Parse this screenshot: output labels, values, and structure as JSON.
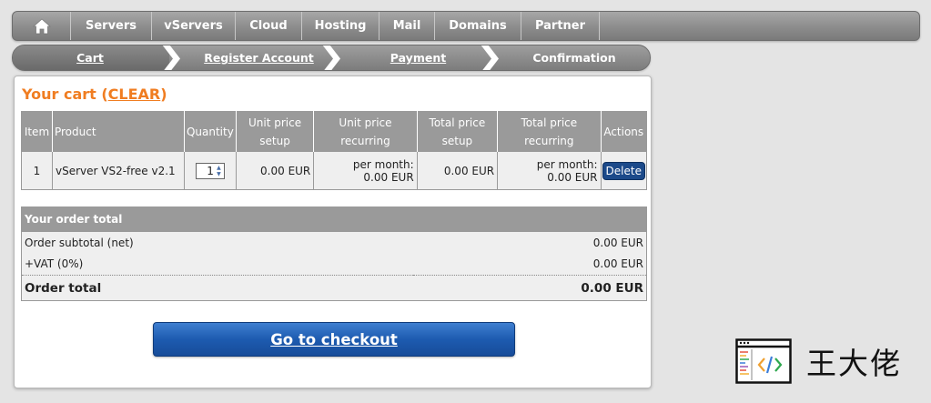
{
  "nav": {
    "home_icon": "home-icon",
    "items": [
      "Servers",
      "vServers",
      "Cloud",
      "Hosting",
      "Mail",
      "Domains",
      "Partner"
    ]
  },
  "steps": [
    {
      "label": "Cart",
      "active": true
    },
    {
      "label": "Register Account",
      "active": false
    },
    {
      "label": "Payment",
      "active": false
    },
    {
      "label": "Confirmation",
      "active": false
    }
  ],
  "cart": {
    "title": "Your cart (",
    "clear_label": "CLEAR",
    "title_end": ")",
    "accent_color": "#f07d21",
    "columns": {
      "item": "Item",
      "product": "Product",
      "quantity": "Quantity",
      "unit_setup": "Unit price setup",
      "unit_recurring": "Unit price recurring",
      "total_setup": "Total price setup",
      "total_recurring": "Total price recurring",
      "actions": "Actions"
    },
    "rows": [
      {
        "item": "1",
        "product": "vServer VS2-free v2.1",
        "quantity": "1",
        "unit_setup": "0.00 EUR",
        "unit_recurring_label": "per month:",
        "unit_recurring_value": "0.00 EUR",
        "total_setup": "0.00 EUR",
        "total_recurring_label": "per month:",
        "total_recurring_value": "0.00 EUR",
        "action_label": "Delete"
      }
    ]
  },
  "order_total": {
    "header": "Your order total",
    "subtotal_label": "Order subtotal (net)",
    "subtotal_value": "0.00 EUR",
    "vat_label": "+VAT (0%)",
    "vat_value": "0.00 EUR",
    "total_label": "Order total",
    "total_value": "0.00 EUR"
  },
  "checkout_label": "Go to checkout",
  "watermark": {
    "text": "王大佬",
    "icon": "code-window-icon"
  }
}
